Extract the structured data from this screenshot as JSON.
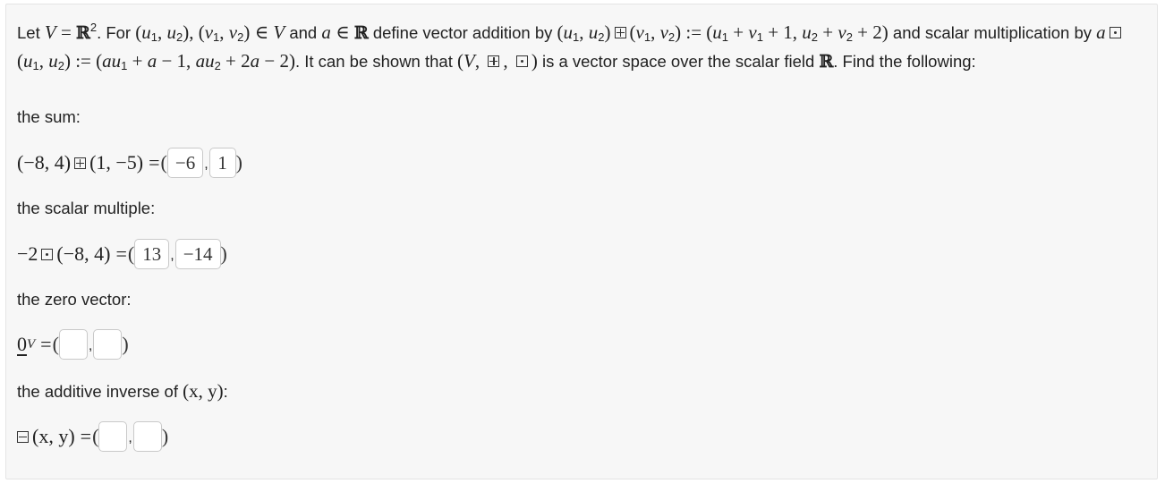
{
  "prompt": {
    "t1": "Let ",
    "t2": ". For ",
    "t3": " and ",
    "t4": " define vector addition by ",
    "t5": " and scalar multiplication by ",
    "t6": ". It can be shown that ",
    "t7": " is a vector space over the scalar field ",
    "t8": ". Find the following:"
  },
  "sum": {
    "label": "the sum:",
    "expr_left": "(−8, 4)",
    "expr_right": "(1, −5)",
    "answers": [
      "−6",
      "1"
    ]
  },
  "scalar": {
    "label": "the scalar multiple:",
    "expr_coef": "−2",
    "expr_vec": "(−8, 4)",
    "answers": [
      "13",
      "−14"
    ]
  },
  "zero": {
    "label": "the zero vector:",
    "symbol": "0",
    "subscript": "V",
    "answers": [
      "",
      ""
    ]
  },
  "inverse": {
    "label": "the additive inverse of ",
    "label_math": "(x, y)",
    "label_end": ":",
    "expr": "(x, y)",
    "answers": [
      "",
      ""
    ]
  }
}
